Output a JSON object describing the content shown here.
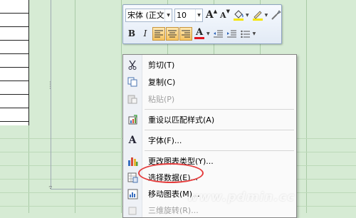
{
  "mini_toolbar": {
    "font_name": "宋体 (正文",
    "font_size": "10",
    "buttons": {
      "grow_font": "A",
      "shrink_font": "A",
      "bold": "B",
      "italic": "I",
      "font_color": "A"
    },
    "font_color_hex": "#e0141e",
    "highlight_color_hex": "#f5e600"
  },
  "context_menu": {
    "items": [
      {
        "label": "剪切(T)",
        "icon": "scissors-icon",
        "enabled": true
      },
      {
        "label": "复制(C)",
        "icon": "copy-icon",
        "enabled": true
      },
      {
        "label": "粘贴(P)",
        "icon": "paste-icon",
        "enabled": false
      },
      {
        "label": "重设以匹配样式(A)",
        "icon": "reset-style-icon",
        "enabled": true
      },
      {
        "label": "字体(F)...",
        "icon": "font-icon",
        "enabled": true
      },
      {
        "label": "更改图表类型(Y)...",
        "icon": "chart-type-icon",
        "enabled": true
      },
      {
        "label": "选择数据(E)...",
        "icon": "select-data-icon",
        "enabled": true
      },
      {
        "label": "移动图表(M)...",
        "icon": "move-chart-icon",
        "enabled": true
      },
      {
        "label": "三维旋转(R)...",
        "icon": "3d-rotate-icon",
        "enabled": false
      }
    ]
  },
  "annotation": {
    "highlight_color": "#e53b3b",
    "highlighted_item": "选择数据(E)..."
  },
  "watermark": {
    "text": "www.pdmin.cc"
  }
}
